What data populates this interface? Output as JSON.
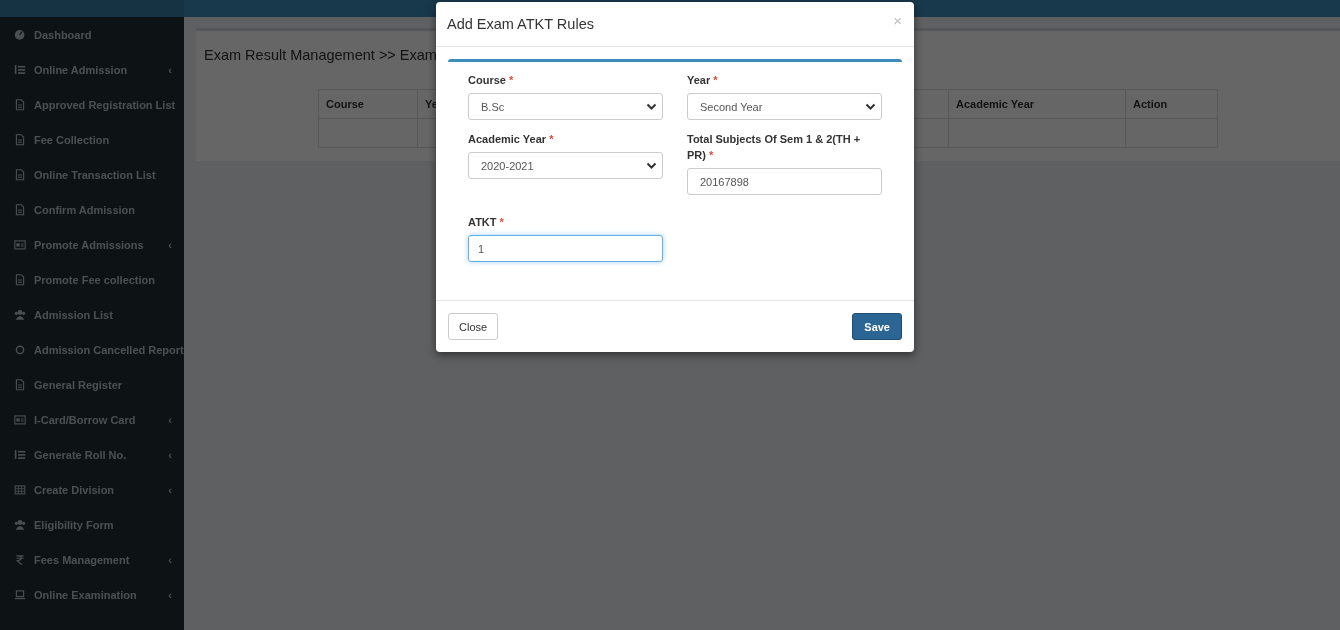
{
  "sidebar": {
    "items": [
      {
        "label": "Dashboard",
        "kind": "dashboard"
      },
      {
        "label": "Online Admission",
        "kind": "list",
        "chevron": "‹"
      },
      {
        "label": "Approved Registration List",
        "kind": "file"
      },
      {
        "label": "Fee Collection",
        "kind": "file"
      },
      {
        "label": "Online Transaction List",
        "kind": "file"
      },
      {
        "label": "Confirm Admission",
        "kind": "file"
      },
      {
        "label": "Promote Admissions",
        "kind": "card",
        "chevron": "‹"
      },
      {
        "label": "Promote Fee collection",
        "kind": "file"
      },
      {
        "label": "Admission List",
        "kind": "users"
      },
      {
        "label": "Admission Cancelled Report",
        "kind": "circle"
      },
      {
        "label": "General Register",
        "kind": "file"
      },
      {
        "label": "I-Card/Borrow Card",
        "kind": "card",
        "chevron": "‹"
      },
      {
        "label": "Generate Roll No.",
        "kind": "list",
        "chevron": "‹"
      },
      {
        "label": "Create Division",
        "kind": "table",
        "chevron": "‹"
      },
      {
        "label": "Eligibility Form",
        "kind": "users"
      },
      {
        "label": "Fees Management",
        "kind": "rupee",
        "chevron": "‹"
      },
      {
        "label": "Online Examination",
        "kind": "laptop",
        "chevron": "‹"
      }
    ]
  },
  "content": {
    "breadcrumb": "Exam Result Management >> Exam",
    "table": {
      "columns": [
        {
          "label": "Course"
        },
        {
          "label": "Ye"
        },
        {
          "label": "Academic Year"
        },
        {
          "label": "Action"
        }
      ]
    }
  },
  "modal": {
    "title": "Add Exam ATKT Rules",
    "close_icon": "×",
    "fields": [
      {
        "label": "Course",
        "required_mark": "*",
        "kind": "select",
        "value": "B.Sc",
        "focused": false
      },
      {
        "label": "Year",
        "required_mark": "*",
        "kind": "select",
        "value": "Second Year",
        "focused": false
      },
      {
        "label": "Academic Year",
        "required_mark": "*",
        "kind": "select",
        "value": "2020-2021",
        "focused": false
      },
      {
        "label": "Total Subjects Of Sem 1 & 2(TH + PR)",
        "required_mark": "*",
        "kind": "input",
        "value": "20167898",
        "focused": false
      },
      {
        "label": "ATKT",
        "required_mark": "*",
        "kind": "input",
        "value": "1",
        "focused": true
      }
    ],
    "buttons": [
      {
        "label": "Close",
        "kind": "default"
      },
      {
        "label": "Save",
        "kind": "primary"
      }
    ]
  }
}
